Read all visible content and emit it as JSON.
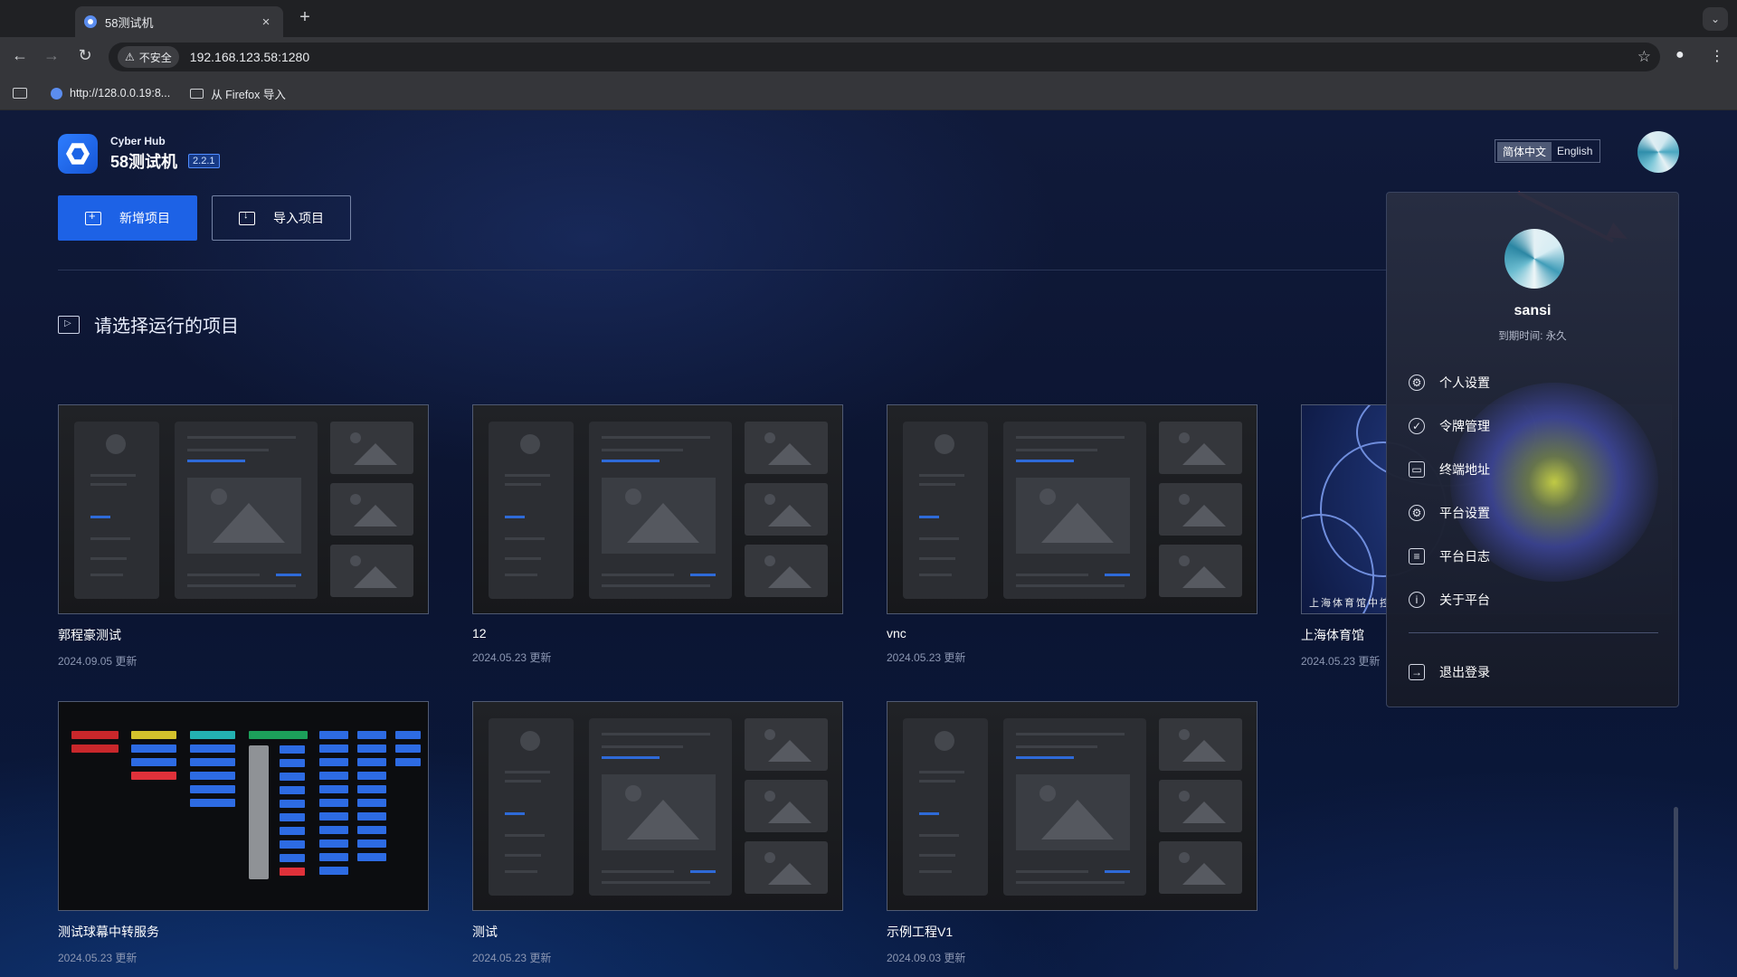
{
  "browser": {
    "tab_title": "58测试机",
    "tab_close": "×",
    "new_tab": "+",
    "tab_menu": "⌄",
    "security_label": "不安全",
    "url": "192.168.123.58:1280",
    "bookmarks": [
      {
        "label": "http://128.0.0.19:8..."
      },
      {
        "label": "从 Firefox 导入"
      }
    ]
  },
  "app": {
    "brand_sub": "Cyber Hub",
    "brand_name": "58测试机",
    "version": "2.2.1",
    "add_project_label": "新增项目",
    "import_project_label": "导入项目",
    "section_title": "请选择运行的项目",
    "language": {
      "active": "简体中文",
      "inactive": "English"
    },
    "projects": [
      {
        "name": "郭程豪测试",
        "date": "2024.09.05 更新"
      },
      {
        "name": "12",
        "date": "2024.05.23 更新"
      },
      {
        "name": "vnc",
        "date": "2024.05.23 更新"
      },
      {
        "name": "上海体育馆",
        "date": "2024.05.23 更新",
        "thumb_label": "上海体育馆中控"
      },
      {
        "name": "测试球幕中转服务",
        "date": "2024.05.23 更新"
      },
      {
        "name": "测试",
        "date": "2024.05.23 更新"
      },
      {
        "name": "示例工程V1",
        "date": "2024.09.03 更新"
      }
    ]
  },
  "user_menu": {
    "username": "sansi",
    "expiry": "到期时间: 永久",
    "items": [
      {
        "label": "个人设置",
        "icon": "settings-icon"
      },
      {
        "label": "令牌管理",
        "icon": "shield-icon"
      },
      {
        "label": "终端地址",
        "icon": "terminal-icon"
      },
      {
        "label": "平台设置",
        "icon": "gear-icon"
      },
      {
        "label": "平台日志",
        "icon": "log-icon"
      },
      {
        "label": "关于平台",
        "icon": "info-icon"
      }
    ],
    "logout": "退出登录"
  },
  "colors": {
    "primary": "#1d62e6",
    "background": "#0e1631",
    "annotation_arrow": "#e53030"
  }
}
